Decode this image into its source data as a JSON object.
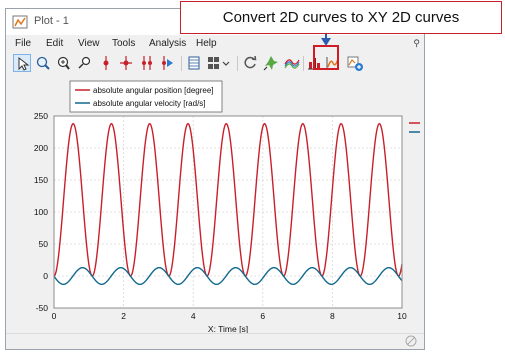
{
  "window": {
    "title": "Plot - 1"
  },
  "menu": {
    "file": "File",
    "edit": "Edit",
    "view": "View",
    "tools": "Tools",
    "analysis": "Analysis",
    "help": "Help"
  },
  "callout": {
    "text": "Convert 2D curves to XY 2D curves"
  },
  "toolbar": {
    "buttons": [
      "select-tool",
      "zoom-tool",
      "zoom-box-tool",
      "data-cursor",
      "cursor-2",
      "cursor-3",
      "cursor-4",
      "cursor-play",
      "table-view",
      "grid-menu",
      "refresh",
      "pin-tool",
      "surface-tool",
      "histogram-tool",
      "convert-xy-tool",
      "add-plot-tool"
    ],
    "highlighted": "convert-xy-tool"
  },
  "colors": {
    "series1": "#c8202a",
    "series2": "#12698c",
    "highlight": "#d01c24",
    "grid": "#d7d7d7"
  },
  "chart_data": {
    "type": "line",
    "xlabel": "X: Time [s]",
    "xlim": [
      0,
      10
    ],
    "ylim": [
      -50,
      250
    ],
    "xticks": [
      0,
      2,
      4,
      6,
      8,
      10
    ],
    "yticks": [
      -50,
      0,
      50,
      100,
      150,
      200,
      250
    ],
    "grid": true,
    "legend_position": "top-left",
    "series": [
      {
        "name": "absolute angular position [degree]",
        "color": "#c8202a",
        "kind": "periodic",
        "period": 1.1,
        "min": 0,
        "max": 238,
        "phase": 0
      },
      {
        "name": "absolute angular velocity [rad/s]",
        "color": "#12698c",
        "kind": "periodic",
        "period": 1.1,
        "min": -13,
        "max": 13,
        "phase": 0.27
      }
    ]
  }
}
